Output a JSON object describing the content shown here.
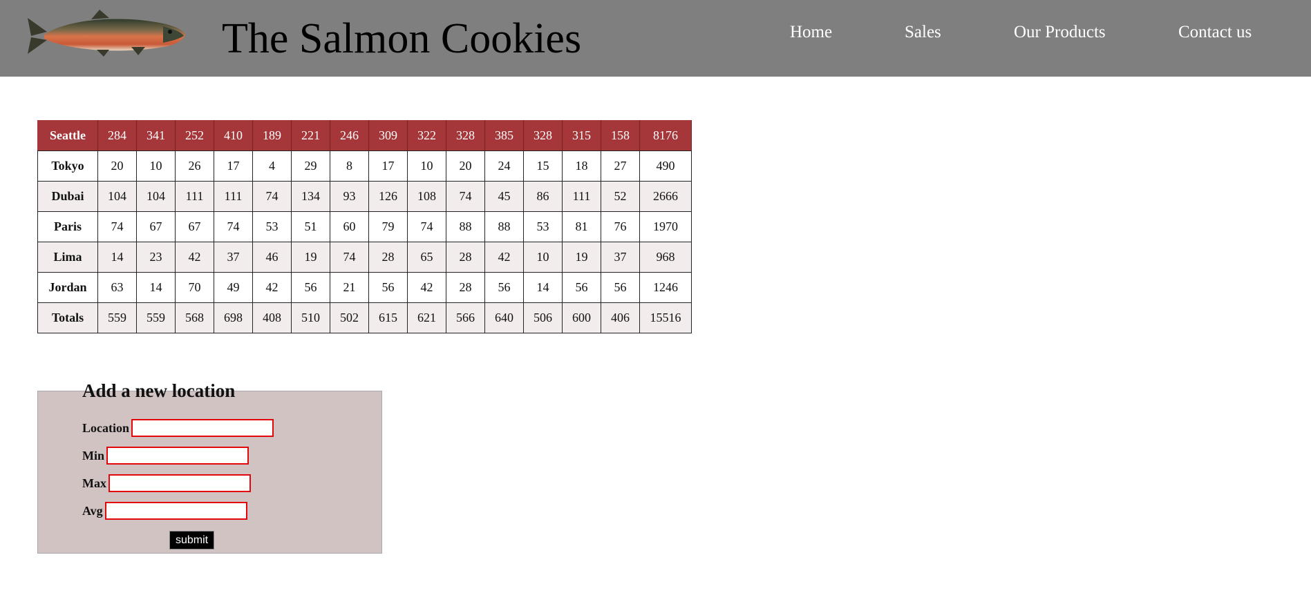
{
  "header": {
    "title": "The Salmon Cookies",
    "logo": "salmon-fish-image",
    "nav": [
      "Home",
      "Sales",
      "Our Products",
      "Contact us"
    ]
  },
  "table": {
    "rows": [
      {
        "location": "Seattle",
        "values": [
          "284",
          "341",
          "252",
          "410",
          "189",
          "221",
          "246",
          "309",
          "322",
          "328",
          "385",
          "328",
          "315",
          "158"
        ],
        "total": "8176"
      },
      {
        "location": "Tokyo",
        "values": [
          "20",
          "10",
          "26",
          "17",
          "4",
          "29",
          "8",
          "17",
          "10",
          "20",
          "24",
          "15",
          "18",
          "27"
        ],
        "total": "490"
      },
      {
        "location": "Dubai",
        "values": [
          "104",
          "104",
          "111",
          "111",
          "74",
          "134",
          "93",
          "126",
          "108",
          "74",
          "45",
          "86",
          "111",
          "52"
        ],
        "total": "2666"
      },
      {
        "location": "Paris",
        "values": [
          "74",
          "67",
          "67",
          "74",
          "53",
          "51",
          "60",
          "79",
          "74",
          "88",
          "88",
          "53",
          "81",
          "76"
        ],
        "total": "1970"
      },
      {
        "location": "Lima",
        "values": [
          "14",
          "23",
          "42",
          "37",
          "46",
          "19",
          "74",
          "28",
          "65",
          "28",
          "42",
          "10",
          "19",
          "37"
        ],
        "total": "968"
      },
      {
        "location": "Jordan",
        "values": [
          "63",
          "14",
          "70",
          "49",
          "42",
          "56",
          "21",
          "56",
          "42",
          "28",
          "56",
          "14",
          "56",
          "56"
        ],
        "total": "1246"
      },
      {
        "location": "Totals",
        "values": [
          "559",
          "559",
          "568",
          "698",
          "408",
          "510",
          "502",
          "615",
          "621",
          "566",
          "640",
          "506",
          "600",
          "406"
        ],
        "total": "15516"
      }
    ]
  },
  "form": {
    "title": "Add a new location",
    "location_label": "Location",
    "min_label": "Min",
    "max_label": "Max",
    "avg_label": "Avg",
    "location_value": "",
    "min_value": "",
    "max_value": "",
    "avg_value": "",
    "submit_label": "submit"
  },
  "colors": {
    "header_bg": "#7f7f7f",
    "seattle_row": "#a5363a",
    "form_bg": "#d2c3c3",
    "input_border": "#e2070d"
  }
}
